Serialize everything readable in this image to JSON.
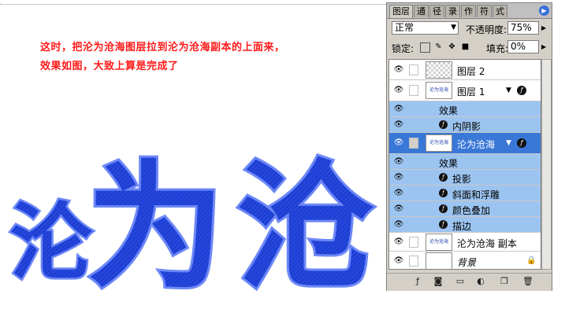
{
  "instructions": {
    "line1": "这时，把沦为沧海图层拉到沦为沧海副本的上面来，",
    "line2": "效果如图，大致上算是完成了"
  },
  "artwork": {
    "glyph1": "沦",
    "glyph2": "为",
    "glyph3": "沧",
    "fill_color": "#1f3fd9",
    "stroke_color": "#5f7df5"
  },
  "palette": {
    "tabs": [
      "图层",
      "通",
      "径",
      "录",
      "作",
      "符",
      "式"
    ],
    "tab_menu_icon": "palette-menu-arrow",
    "blend_mode": "正常",
    "opacity_label": "不透明度:",
    "opacity_value": "75%",
    "lock_label": "锁定:",
    "fill_label": "填充:",
    "fill_value": "0%",
    "layers": [
      {
        "name": "图层 2",
        "visible": true,
        "thumb": "transparent"
      },
      {
        "name": "图层 1",
        "visible": true,
        "thumb": "沦为沧海",
        "has_fx": true
      },
      {
        "name": "沦为沧海",
        "visible": true,
        "thumb": "沦为沧海",
        "has_fx": true,
        "selected": true
      },
      {
        "name": "沦为沧海 副本",
        "visible": true,
        "thumb": "沦为沧海"
      },
      {
        "name": "背景",
        "visible": true,
        "thumb": "white",
        "locked": true
      }
    ],
    "layer1_effects": {
      "header": "效果",
      "items": [
        "内阴影"
      ]
    },
    "layer_main_effects": {
      "header": "效果",
      "items": [
        "投影",
        "斜面和浮雕",
        "颜色叠加",
        "描边"
      ]
    },
    "bottom_buttons": [
      "link-icon",
      "add-style-icon",
      "mask-icon",
      "new-set-icon",
      "adjustment-icon",
      "new-layer-icon",
      "trash-icon"
    ],
    "colors": {
      "selection": "#9cc4f0",
      "panel": "#d4d0c8"
    }
  }
}
